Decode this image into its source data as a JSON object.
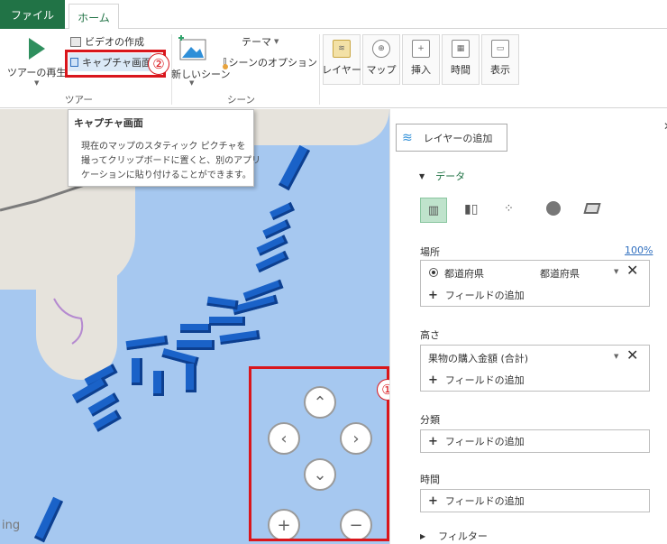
{
  "tabs": {
    "file": "ファイル",
    "home": "ホーム"
  },
  "ribbon": {
    "tour_play": "ツアーの再生",
    "create_video": "ビデオの作成",
    "capture_screen": "キャプチャ画面",
    "group_tour": "ツアー",
    "new_scene": "新しいシーン",
    "theme": "テーマ",
    "scene_options": "シーンのオプション",
    "group_scene": "シーン",
    "layer": "レイヤー",
    "map": "マップ",
    "insert": "挿入",
    "time": "時間",
    "display": "表示"
  },
  "tooltip": {
    "title": "キャプチャ画面",
    "line1": "現在のマップのスタティック ピクチャを",
    "line2": "撮ってクリップボードに置くと、別のアプリ",
    "line3": "ケーションに貼り付けることができます。"
  },
  "annotations": {
    "one": "①",
    "two": "②"
  },
  "map": {
    "watermark": "ing"
  },
  "panel": {
    "add_layer": "レイヤーの追加",
    "data_header": "データ",
    "location_label": "場所",
    "location_percent": "100%",
    "location_field": "都道府県",
    "location_type": "都道府県",
    "add_field": "フィールドの追加",
    "height_label": "高さ",
    "height_field": "果物の購入金額 (合計)",
    "category_label": "分類",
    "time_label": "時間",
    "filter_label": "フィルター"
  },
  "colors": {
    "excel_green": "#217346",
    "annotation_red": "#d9161c",
    "bar_blue": "#1a62c8",
    "sea": "#a6c8f0"
  }
}
